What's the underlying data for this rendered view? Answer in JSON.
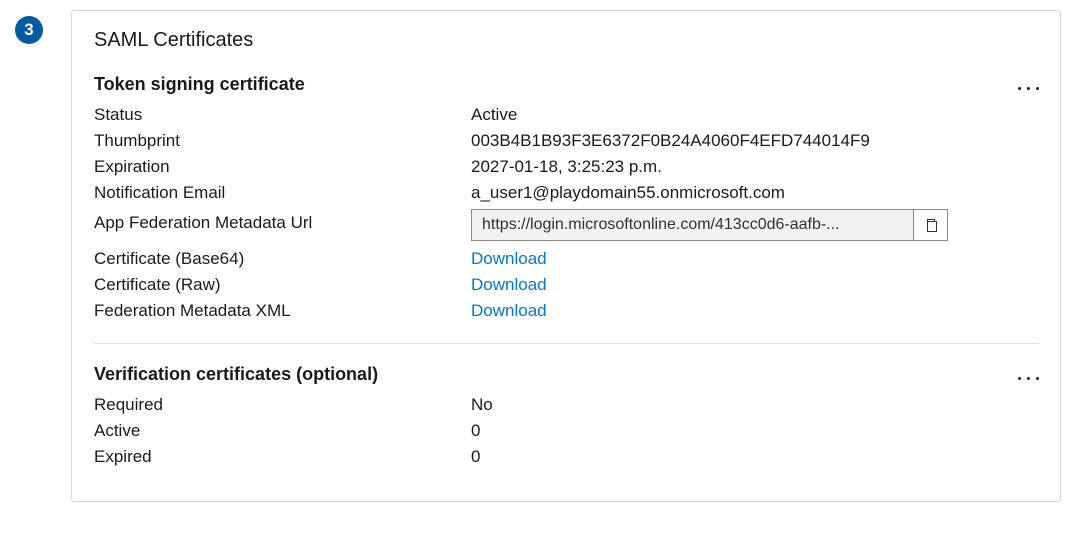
{
  "step_number": "3",
  "card_title": "SAML Certificates",
  "token_signing": {
    "title": "Token signing certificate",
    "status_label": "Status",
    "status_value": "Active",
    "thumbprint_label": "Thumbprint",
    "thumbprint_value": "003B4B1B93F3E6372F0B24A4060F4EFD744014F9",
    "expiration_label": "Expiration",
    "expiration_value": "2027-01-18, 3:25:23 p.m.",
    "notification_email_label": "Notification Email",
    "notification_email_value": "a_user1@playdomain55.onmicrosoft.com",
    "metadata_url_label": "App Federation Metadata Url",
    "metadata_url_value": "https://login.microsoftonline.com/413cc0d6-aafb-...",
    "cert_base64_label": "Certificate (Base64)",
    "cert_base64_link": "Download",
    "cert_raw_label": "Certificate (Raw)",
    "cert_raw_link": "Download",
    "fed_metadata_xml_label": "Federation Metadata XML",
    "fed_metadata_xml_link": "Download"
  },
  "verification": {
    "title": "Verification certificates (optional)",
    "required_label": "Required",
    "required_value": "No",
    "active_label": "Active",
    "active_value": "0",
    "expired_label": "Expired",
    "expired_value": "0"
  }
}
